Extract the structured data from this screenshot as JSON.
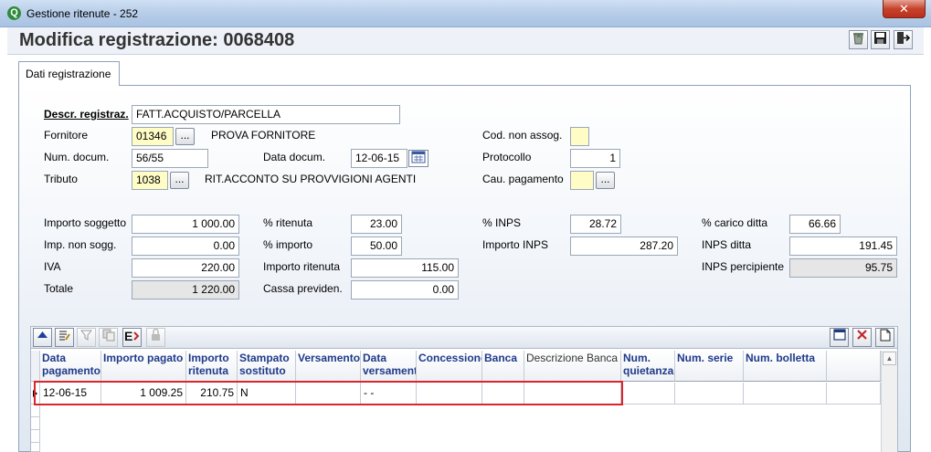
{
  "window": {
    "title": "Gestione ritenute - 252",
    "close_glyph": "✕",
    "app_icon": "Q"
  },
  "header": {
    "title": "Modifica  registrazione: 0068408"
  },
  "toolbar": {
    "icons": [
      "recycle-icon",
      "save-icon",
      "exit-icon"
    ]
  },
  "tabs": [
    {
      "label": "Dati registrazione"
    }
  ],
  "form": {
    "descr_label": "Descr. registraz.",
    "descr_value": "FATT.ACQUISTO/PARCELLA",
    "fornitore_label": "Fornitore",
    "fornitore_code": "01346",
    "fornitore_name": "PROVA FORNITORE",
    "num_docum_label": "Num. docum.",
    "num_docum_value": "56/55",
    "data_docum_label": "Data docum.",
    "data_docum_value": "12-06-15",
    "tributo_label": "Tributo",
    "tributo_code": "1038",
    "tributo_desc": "RIT.ACCONTO SU PROVVIGIONI AGENTI",
    "cod_non_assog_label": "Cod. non assog.",
    "cod_non_assog_value": "",
    "protocollo_label": "Protocollo",
    "protocollo_value": "1",
    "cau_pagamento_label": "Cau. pagamento",
    "cau_pagamento_value": "",
    "importo_soggetto_label": "Importo soggetto",
    "importo_soggetto_value": "1 000.00",
    "imp_non_sogg_label": "Imp. non sogg.",
    "imp_non_sogg_value": "0.00",
    "iva_label": "IVA",
    "iva_value": "220.00",
    "totale_label": "Totale",
    "totale_value": "1 220.00",
    "perc_ritenuta_label": "% ritenuta",
    "perc_ritenuta_value": "23.00",
    "perc_importo_label": "% importo",
    "perc_importo_value": "50.00",
    "importo_ritenuta_label": "Importo ritenuta",
    "importo_ritenuta_value": "115.00",
    "cassa_previden_label": "Cassa previden.",
    "cassa_previden_value": "0.00",
    "perc_inps_label": "% INPS",
    "perc_inps_value": "28.72",
    "importo_inps_label": "Importo INPS",
    "importo_inps_value": "287.20",
    "perc_carico_ditta_label": "% carico ditta",
    "perc_carico_ditta_value": "66.66",
    "inps_ditta_label": "INPS ditta",
    "inps_ditta_value": "191.45",
    "inps_percipiente_label": "INPS percipiente",
    "inps_percipiente_value": "95.75",
    "dots_label": "..."
  },
  "grid": {
    "toolbar_icons": [
      "move-up-icon",
      "edit-list-icon",
      "filter-icon",
      "copy-icon",
      "export-icon",
      "lock-icon",
      "window-icon",
      "delete-icon",
      "new-document-icon"
    ],
    "columns": [
      {
        "label": "Data pagamento"
      },
      {
        "label": "Importo pagato"
      },
      {
        "label": "Importo ritenuta"
      },
      {
        "label": "Stampato sostituto"
      },
      {
        "label": "Versamento"
      },
      {
        "label": "Data versamento"
      },
      {
        "label": "Concessione"
      },
      {
        "label": "Banca"
      },
      {
        "label": "Descrizione Banca"
      },
      {
        "label": "Num. quietanza"
      },
      {
        "label": "Num. serie"
      },
      {
        "label": "Num. bolletta"
      }
    ],
    "rows": [
      [
        "12-06-15",
        "1 009.25",
        "210.75",
        "N",
        "",
        "- -",
        "",
        "",
        "",
        "",
        "",
        ""
      ]
    ]
  }
}
